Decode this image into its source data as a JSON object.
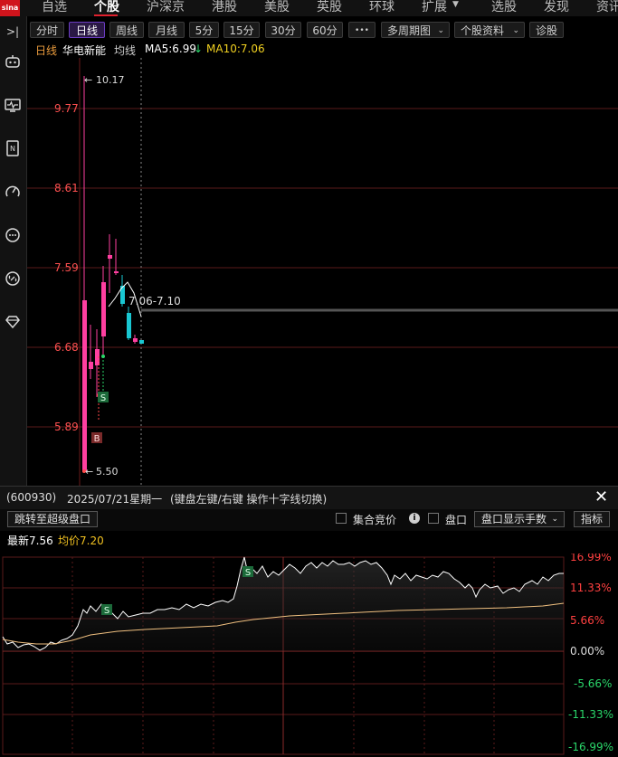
{
  "nav": {
    "items": [
      "自选",
      "个股",
      "沪深京",
      "港股",
      "美股",
      "英股",
      "环球",
      "扩展",
      "选股",
      "发现",
      "资讯"
    ],
    "active": "个股",
    "logo_text": "sinа"
  },
  "periods": {
    "buttons": [
      "分时",
      "日线",
      "周线",
      "月线",
      "5分",
      "15分",
      "30分",
      "60分",
      "•••",
      "多周期图",
      "个股资料",
      "诊股"
    ],
    "active": "日线"
  },
  "legend": {
    "period": "日线",
    "name": "华电新能",
    "avg": "均线",
    "ma5": "MA5:6.99",
    "ma10": "MA10:7.06"
  },
  "kline": {
    "ticks": [
      "9.77",
      "8.61",
      "7.59",
      "6.68",
      "5.89"
    ],
    "high_label": "10.17",
    "low_label": "5.50",
    "range_label": "7.06-7.10",
    "buy_marker": "B",
    "sell_marker": "S",
    "colors": {
      "up": "#ff3fa0",
      "down": "#19c7d2",
      "grid": "#5a1a1a",
      "axis_text": "#ff5050"
    }
  },
  "detail": {
    "code": "(600930)",
    "date": "2025/07/21星期一",
    "hint": "(键盘左键/右键 操作十字线切换)",
    "jump_button": "跳转至超级盘口",
    "auction": "集合竞价",
    "info_icon": "i",
    "pankou": "盘口",
    "pankou_mode": "盘口显示手数",
    "indicator": "指标",
    "last_label": "最新7.56",
    "avg_label": "均价7.20"
  },
  "intraday": {
    "right_ticks": [
      "16.99%",
      "11.33%",
      "5.66%",
      "0.00%",
      "-5.66%",
      "-11.33%",
      "-16.99%"
    ],
    "sell_marker": "S"
  }
}
